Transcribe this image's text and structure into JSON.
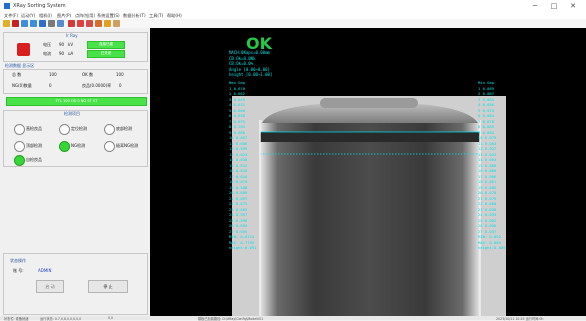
{
  "window": {
    "title": "XRay Sorting System",
    "minimize": "─",
    "maximize": "□",
    "close": "✕"
  },
  "menu": [
    "文件(F)",
    "运动(Y)",
    "相机(I)",
    "图片(P)",
    "点阵(铅用)",
    "系统设置(S)",
    "数据分析(T)",
    "工具(T)",
    "帮助(H)"
  ],
  "toolbar_icons": [
    "open-icon",
    "grid-icon",
    "zoom-in-icon",
    "zoom-out-icon",
    "save-icon",
    "settings-icon",
    "settings-icon",
    "cut-icon",
    "delete-icon",
    "check-icon",
    "line-icon",
    "pen-icon",
    "ruler-icon"
  ],
  "info": {
    "title": "Ir Ray",
    "row1": {
      "label": "电压",
      "value": "90",
      "unit": "kV",
      "status": "连接已建"
    },
    "row2": {
      "label": "电流",
      "value": "90",
      "unit": "uA",
      "status": "已关闭"
    }
  },
  "stats": {
    "title": "检测数据 显示区",
    "total_label": "总 数",
    "total_value": "100",
    "ok_label": "OK 数",
    "ok_value": "100",
    "ng_label": "NG(0)数量",
    "ng_value": "0",
    "rate_label": "良品(0.0000)率",
    "rate_value": "0",
    "banner": "TTL  100  OK  0  NG  ST  ST"
  },
  "detect": {
    "title": "检测项目",
    "items": [
      {
        "label": "直检良品",
        "on": false
      },
      {
        "label": "定位检测",
        "on": false
      },
      {
        "label": "底部检测",
        "on": false
      },
      {
        "label": "顶部检测",
        "on": false
      },
      {
        "label": "NG检测",
        "on": true
      },
      {
        "label": "极耳NG检测",
        "on": false
      },
      {
        "label": "自检良品",
        "on": true
      }
    ]
  },
  "bottom": {
    "title": "状态操作",
    "label": "账 号:",
    "value": "ADMIN",
    "start": "启 动",
    "stop": "停 止"
  },
  "image": {
    "verdict": "OK",
    "info_lines": [
      "MACH:0Kaps=0.00mm",
      "CB:Ok=0.0Nk",
      "CB:Ok=0.0%",
      "Angle [0.00~0.00]",
      "height [0.00~1.00]"
    ],
    "left_header": "Max Gap",
    "right_header": "Min Gap",
    "left_values": [
      "1 0.670",
      "2 0.682",
      "3 0.649",
      "4 0.631",
      "5 0.666",
      "6 0.658",
      "7 0.675",
      "8 0.705",
      "9 0.680",
      "10 0.667",
      "11 0.606",
      "12 0.599",
      "13 0.624",
      "14 0.638",
      "15 0.612",
      "16 0.616",
      "17 0.616",
      "18 0.670",
      "19 0.588",
      "20 0.609",
      "21 0.697",
      "22 0.675",
      "23 0.665",
      "24 0.597",
      "25 0.596",
      "26 0.694",
      "27 0.695"
    ],
    "right_values": [
      "1 0.089",
      "2 0.087",
      "3 0.085",
      "4 0.096",
      "5 0.074",
      "6 0.084",
      "7 0.078",
      "8 0.085",
      "9 0.083",
      "10 0.079",
      "11 0.064",
      "12 0.057",
      "13 0.052",
      "14 0.064",
      "15 0.068",
      "16 0.060",
      "17 0.066",
      "18 0.061",
      "19 0.085",
      "20 0.070",
      "21 0.079",
      "22 0.068",
      "23 0.058",
      "24 0.053",
      "25 0.062",
      "26 0.056",
      "27 0.057"
    ],
    "left_footer": [
      "MIN: 0.6714",
      "MAX:  0.7705",
      "height:0.691"
    ],
    "right_footer": [
      "MIN: 0.052",
      "MAX: 0.089",
      "height:0.089"
    ]
  },
  "status": {
    "left": "状态栏: 准备就绪",
    "mid": "运行状态: 0.7,0,8,0,0,0,0,0",
    "coord": "0,0",
    "center": "模板已加载路径: D:\\XRay\\Config\\Model001",
    "right": "2023/10/11 10:25 运行时间:0h"
  },
  "colors": {
    "ok_green": "#24c945",
    "accent_cyan": "#00e2e8",
    "status_green": "#49e249"
  }
}
